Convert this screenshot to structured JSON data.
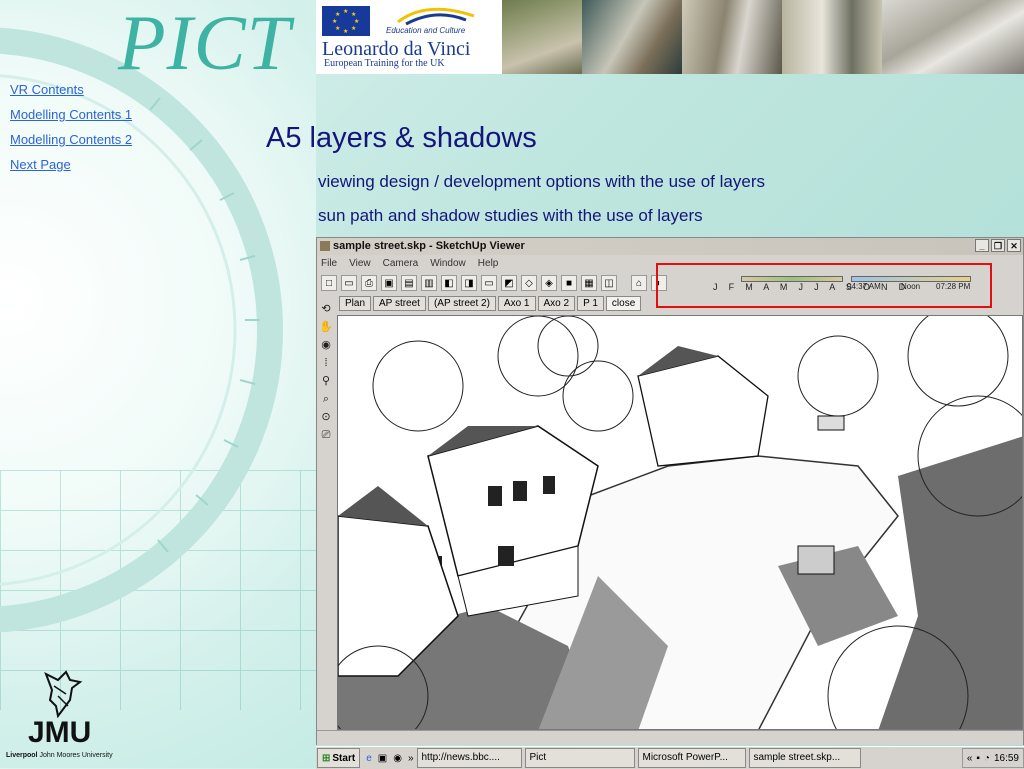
{
  "logo": {
    "text": "PICT"
  },
  "nav": {
    "links": [
      "VR Contents",
      "Modelling Contents 1",
      "Modelling Contents 2",
      "Next Page"
    ]
  },
  "header": {
    "leonardo_small": "Education and Culture",
    "leonardo_main": "Leonardo da Vinci",
    "leonardo_sub": "European Training for the UK"
  },
  "slide": {
    "title": "A5 layers & shadows",
    "subtitle1": "viewing design / development options with the use of layers",
    "subtitle2": "sun path and shadow studies with the use of layers"
  },
  "window": {
    "title": "sample street.skp - SketchUp Viewer",
    "menu": [
      "File",
      "View",
      "Camera",
      "Window",
      "Help"
    ],
    "months": "J F M A M J J A S O N D",
    "time_start": "04:37 AM",
    "time_mid": "Noon",
    "time_end": "07:28 PM",
    "tabs": [
      "Plan",
      "AP street",
      "(AP street 2)",
      "Axo 1",
      "Axo 2",
      "P 1",
      "close"
    ]
  },
  "jmu": {
    "brand": "JMU",
    "uni_bold": "Liverpool",
    "uni_rest": "John Moores University"
  },
  "taskbar": {
    "start": "Start",
    "items": [
      "http://news.bbc....",
      "Pict",
      "Microsoft PowerP...",
      "sample street.skp..."
    ],
    "clock": "16:59"
  },
  "colors": {
    "accent": "#14147a",
    "link": "#2a64d8",
    "highlight": "#e01010",
    "pict": "#3fb3a3"
  }
}
